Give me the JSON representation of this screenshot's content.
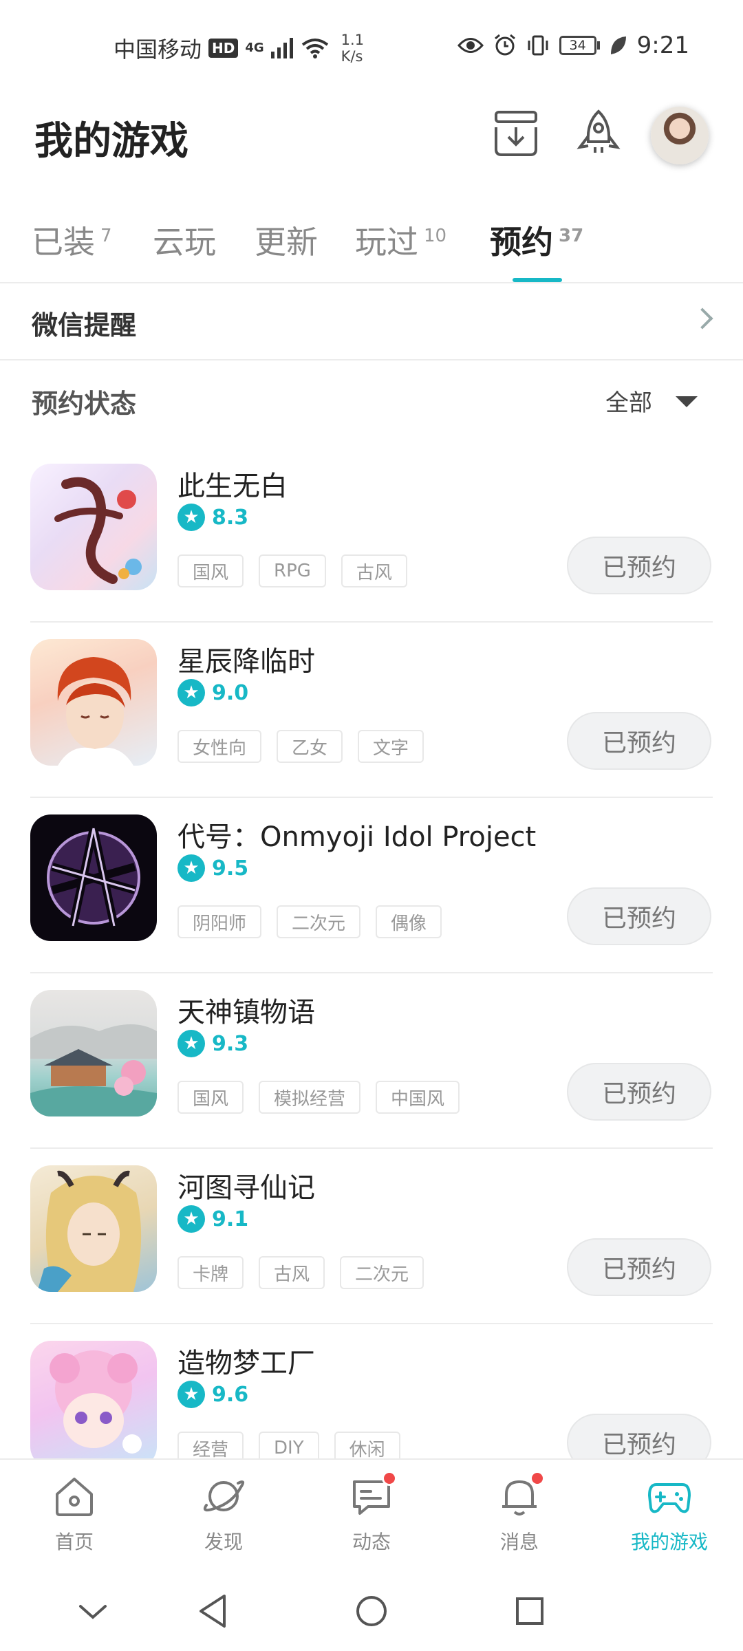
{
  "status_bar": {
    "carrier": "中国移动",
    "hd": "HD",
    "network": "4G",
    "speed_value": "1.1",
    "speed_unit": "K/s",
    "battery": "34",
    "time": "9:21"
  },
  "header": {
    "title": "我的游戏"
  },
  "tabs": [
    {
      "label": "已装",
      "count": "7"
    },
    {
      "label": "云玩",
      "count": ""
    },
    {
      "label": "更新",
      "count": ""
    },
    {
      "label": "玩过",
      "count": "10"
    },
    {
      "label": "预约",
      "count": "37"
    }
  ],
  "wechat_reminder": {
    "label": "微信提醒"
  },
  "filter": {
    "label": "预约状态",
    "value": "全部"
  },
  "games": [
    {
      "name": "此生无白",
      "rating": "8.3",
      "tags": [
        "国风",
        "RPG",
        "古风"
      ],
      "button": "已预约"
    },
    {
      "name": "星辰降临时",
      "rating": "9.0",
      "tags": [
        "女性向",
        "乙女",
        "文字"
      ],
      "button": "已预约"
    },
    {
      "name": "代号：Onmyoji Idol Project",
      "rating": "9.5",
      "tags": [
        "阴阳师",
        "二次元",
        "偶像"
      ],
      "button": "已预约"
    },
    {
      "name": "天神镇物语",
      "rating": "9.3",
      "tags": [
        "国风",
        "模拟经营",
        "中国风"
      ],
      "button": "已预约"
    },
    {
      "name": "河图寻仙记",
      "rating": "9.1",
      "tags": [
        "卡牌",
        "古风",
        "二次元"
      ],
      "button": "已预约"
    },
    {
      "name": "造物梦工厂",
      "rating": "9.6",
      "tags": [
        "经营",
        "DIY",
        "休闲"
      ],
      "button": "已预约"
    }
  ],
  "bottom_nav": [
    {
      "label": "首页",
      "icon": "home-icon"
    },
    {
      "label": "发现",
      "icon": "planet-icon"
    },
    {
      "label": "动态",
      "icon": "chat-icon"
    },
    {
      "label": "消息",
      "icon": "bell-icon"
    },
    {
      "label": "我的游戏",
      "icon": "gamepad-icon"
    }
  ],
  "colors": {
    "accent": "#17b8c6",
    "badge": "#f04848"
  }
}
